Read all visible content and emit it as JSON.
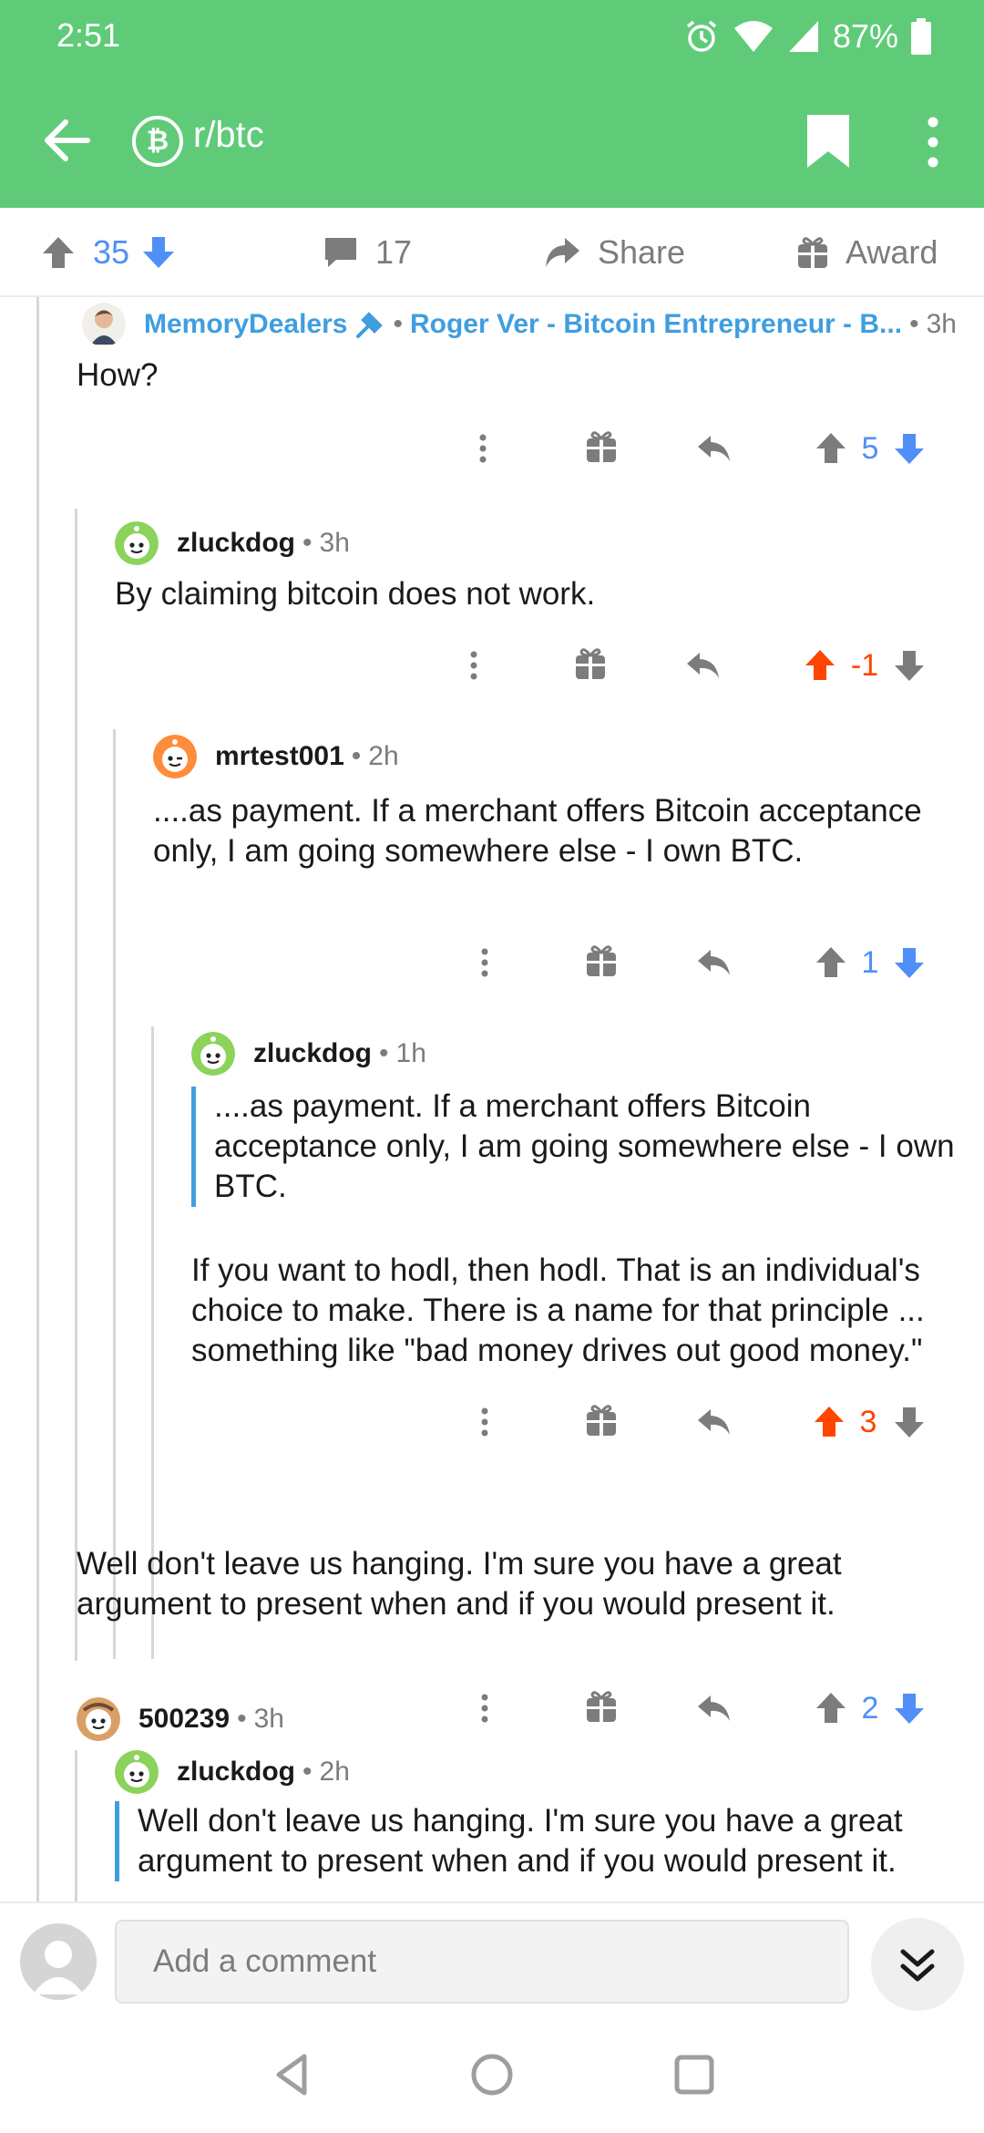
{
  "status_bar": {
    "time": "2:51",
    "battery": "87%"
  },
  "app_bar": {
    "subreddit": "r/btc",
    "subreddit_icon": "₿"
  },
  "post_bar": {
    "score": "35",
    "comments": "17",
    "share_label": "Share",
    "award_label": "Award"
  },
  "comments": [
    {
      "username": "MemoryDealers",
      "flair": "Roger Ver - Bitcoin Entrepreneur - B...",
      "time": "3h",
      "body": "How?",
      "score": "5",
      "vote": "none"
    },
    {
      "username": "zluckdog",
      "time": "3h",
      "body": "By claiming bitcoin does not work.",
      "score": "-1",
      "vote": "up"
    },
    {
      "username": "mrtest001",
      "time": "2h",
      "body": "....as payment.  If a merchant offers Bitcoin acceptance only, I am going somewhere else - I own BTC.",
      "score": "1",
      "vote": "none"
    },
    {
      "username": "zluckdog",
      "time": "1h",
      "quote": "....as payment. If a merchant offers Bitcoin acceptance only, I am going somewhere else - I own BTC.",
      "body": "If you want to hodl, then hodl. That is an individual's choice to make. There is a name for that principle ... something like \"bad money drives out good money.\"",
      "score": "3",
      "vote": "up"
    },
    {
      "username": "500239",
      "time": "3h",
      "body": "Well don't leave us hanging. I'm sure you have a great argument to present when and if you would present it.",
      "score": "2",
      "vote": "none"
    },
    {
      "username": "zluckdog",
      "time": "2h",
      "quote": "Well don't leave us hanging. I'm sure you have a great argument to present when and if you would present it."
    }
  ],
  "comment_bar": {
    "placeholder": "Add a comment"
  },
  "colors": {
    "app_green": "#5fcb78",
    "upvote_orange": "#ff4500",
    "downvote_blue": "#4f8ff7",
    "link_blue": "#3f9ee0",
    "gray_icon": "#7c7c7c"
  }
}
